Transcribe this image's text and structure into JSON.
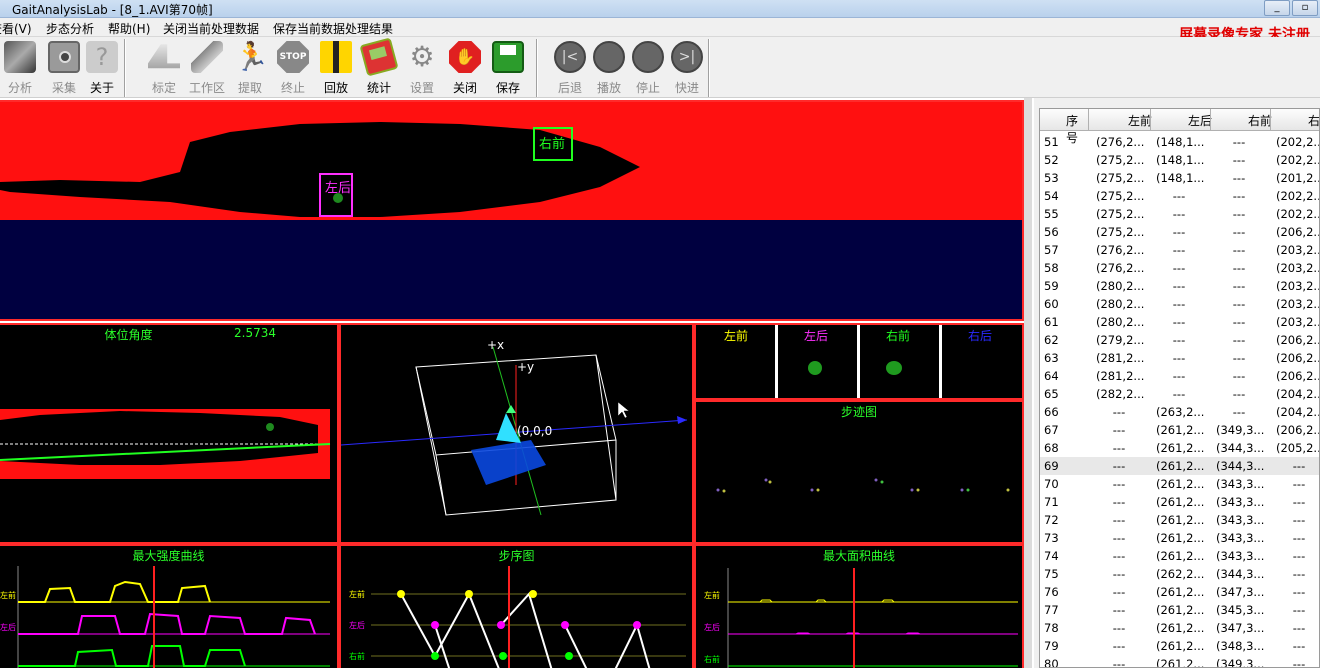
{
  "window": {
    "title": "GaitAnalysisLab - [8_1.AVI第70帧]"
  },
  "menu": [
    "查看(V)",
    "步态分析",
    "帮助(H)",
    "关闭当前处理数据",
    "保存当前数据处理结果"
  ],
  "watermark": "屏幕录像专家 未注册",
  "toolbar": [
    {
      "label": "分析",
      "icon": "analyze-icon",
      "enabled": false
    },
    {
      "label": "采集",
      "icon": "camera-icon",
      "enabled": false
    },
    {
      "label": "关于",
      "icon": "help-icon",
      "enabled": true
    },
    {
      "label": "标定",
      "icon": "calibrate-icon",
      "enabled": false
    },
    {
      "label": "工作区",
      "icon": "pencil-icon",
      "enabled": false
    },
    {
      "label": "提取",
      "icon": "runner-icon",
      "enabled": false
    },
    {
      "label": "终止",
      "icon": "stop-icon",
      "enabled": false
    },
    {
      "label": "回放",
      "icon": "film-icon",
      "enabled": true
    },
    {
      "label": "统计",
      "icon": "calculator-icon",
      "enabled": true
    },
    {
      "label": "设置",
      "icon": "gear-icon",
      "enabled": false
    },
    {
      "label": "关闭",
      "icon": "hand-stop-icon",
      "enabled": true
    },
    {
      "label": "保存",
      "icon": "save-icon",
      "enabled": true
    },
    {
      "label": "后退",
      "icon": "rewind-icon",
      "enabled": false
    },
    {
      "label": "播放",
      "icon": "play-icon",
      "enabled": false
    },
    {
      "label": "停止",
      "icon": "stop-circle-icon",
      "enabled": false
    },
    {
      "label": "快进",
      "icon": "fast-forward-icon",
      "enabled": false
    }
  ],
  "video": {
    "label_right_front": "右前",
    "label_left_hind": "左后"
  },
  "posture": {
    "title": "体位角度",
    "value": "2.5734"
  },
  "plot3d": {
    "axis_x": "+x",
    "axis_y": "+y",
    "origin": "(0,0,0"
  },
  "paws": [
    "左前",
    "左后",
    "右前",
    "右后"
  ],
  "footprint": {
    "title": "步迹图"
  },
  "intensity": {
    "title": "最大强度曲线"
  },
  "sequence": {
    "title": "步序图"
  },
  "area": {
    "title": "最大面积曲线"
  },
  "curve_labels": [
    "左前",
    "左后",
    "右前"
  ],
  "colors": {
    "front_left": "#ffff00",
    "hind_left": "#ff00ff",
    "front_right": "#00ff00",
    "hind_right": "#0000ff",
    "border": "#ff2a2a"
  },
  "table": {
    "headers": [
      "序号",
      "左前",
      "左后",
      "右前",
      "右后"
    ],
    "rows": [
      [
        "51",
        "(276,2...",
        "(148,1...",
        "---",
        "(202,2..."
      ],
      [
        "52",
        "(275,2...",
        "(148,1...",
        "---",
        "(202,2..."
      ],
      [
        "53",
        "(275,2...",
        "(148,1...",
        "---",
        "(201,2..."
      ],
      [
        "54",
        "(275,2...",
        "---",
        "---",
        "(202,2..."
      ],
      [
        "55",
        "(275,2...",
        "---",
        "---",
        "(202,2..."
      ],
      [
        "56",
        "(275,2...",
        "---",
        "---",
        "(206,2..."
      ],
      [
        "57",
        "(276,2...",
        "---",
        "---",
        "(203,2..."
      ],
      [
        "58",
        "(276,2...",
        "---",
        "---",
        "(203,2..."
      ],
      [
        "59",
        "(280,2...",
        "---",
        "---",
        "(203,2..."
      ],
      [
        "60",
        "(280,2...",
        "---",
        "---",
        "(203,2..."
      ],
      [
        "61",
        "(280,2...",
        "---",
        "---",
        "(203,2..."
      ],
      [
        "62",
        "(279,2...",
        "---",
        "---",
        "(206,2..."
      ],
      [
        "63",
        "(281,2...",
        "---",
        "---",
        "(206,2..."
      ],
      [
        "64",
        "(281,2...",
        "---",
        "---",
        "(206,2..."
      ],
      [
        "65",
        "(282,2...",
        "---",
        "---",
        "(204,2..."
      ],
      [
        "66",
        "---",
        "(263,2...",
        "---",
        "(204,2..."
      ],
      [
        "67",
        "---",
        "(261,2...",
        "(349,3...",
        "(206,2..."
      ],
      [
        "68",
        "---",
        "(261,2...",
        "(344,3...",
        "(205,2..."
      ],
      [
        "69",
        "---",
        "(261,2...",
        "(344,3...",
        "---"
      ],
      [
        "70",
        "---",
        "(261,2...",
        "(343,3...",
        "---"
      ],
      [
        "71",
        "---",
        "(261,2...",
        "(343,3...",
        "---"
      ],
      [
        "72",
        "---",
        "(261,2...",
        "(343,3...",
        "---"
      ],
      [
        "73",
        "---",
        "(261,2...",
        "(343,3...",
        "---"
      ],
      [
        "74",
        "---",
        "(261,2...",
        "(343,3...",
        "---"
      ],
      [
        "75",
        "---",
        "(262,2...",
        "(344,3...",
        "---"
      ],
      [
        "76",
        "---",
        "(261,2...",
        "(347,3...",
        "---"
      ],
      [
        "77",
        "---",
        "(261,2...",
        "(345,3...",
        "---"
      ],
      [
        "78",
        "---",
        "(261,2...",
        "(347,3...",
        "---"
      ],
      [
        "79",
        "---",
        "(261,2...",
        "(348,3...",
        "---"
      ],
      [
        "80",
        "---",
        "(261,2...",
        "(349,3...",
        "---"
      ]
    ],
    "selected_row": "69"
  }
}
